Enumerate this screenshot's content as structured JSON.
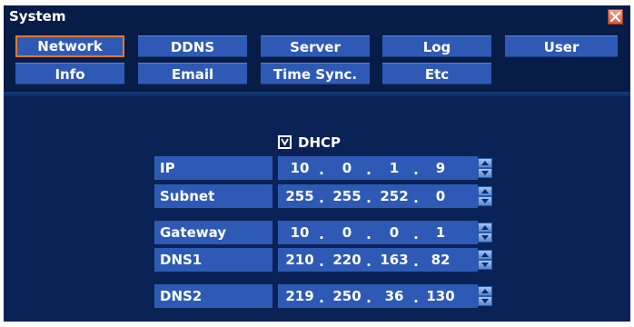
{
  "window": {
    "title": "System"
  },
  "tabs": [
    {
      "label": "Network",
      "selected": true
    },
    {
      "label": "DDNS"
    },
    {
      "label": "Server"
    },
    {
      "label": "Log"
    },
    {
      "label": "User"
    },
    {
      "label": "Info"
    },
    {
      "label": "Email"
    },
    {
      "label": "Time Sync."
    },
    {
      "label": "Etc"
    }
  ],
  "dhcp": {
    "label": "DHCP",
    "checked": true
  },
  "fields": [
    {
      "label": "IP",
      "octets": [
        "10",
        "0",
        "1",
        "9"
      ]
    },
    {
      "label": "Subnet",
      "octets": [
        "255",
        "255",
        "252",
        "0"
      ]
    },
    {
      "label": "Gateway",
      "octets": [
        "10",
        "0",
        "0",
        "1"
      ]
    },
    {
      "label": "DNS1",
      "octets": [
        "210",
        "220",
        "163",
        "82"
      ]
    },
    {
      "label": "DNS2",
      "octets": [
        "219",
        "250",
        "36",
        "130"
      ]
    }
  ],
  "separator": ".",
  "icons": {
    "close": "close-icon",
    "check": "check-icon",
    "up": "spin-up-icon",
    "down": "spin-down-icon"
  },
  "colors": {
    "window_bg": "#0a2255",
    "tab_bg": "#2e5ab6",
    "selected_border": "#e07a2a",
    "close_bg": "#d65a3c"
  }
}
